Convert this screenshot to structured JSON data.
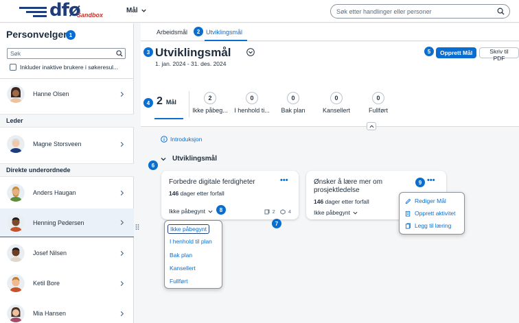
{
  "header": {
    "logo_text": "dfø",
    "logo_tag": "Sandbox",
    "module_label": "Mål",
    "search_placeholder": "Søk etter handlinger eller personer"
  },
  "sidebar": {
    "title": "Personvelger",
    "badge": "1",
    "search_placeholder": "Søk",
    "include_inactive_label": "Inkluder inaktive brukere i søkeresul...",
    "current_user": "Hanne Olsen",
    "leader_group": "Leder",
    "leader": "Magne Storsveen",
    "reports_group": "Direkte underordnede",
    "reports": [
      "Anders Haugan",
      "Henning Pedersen",
      "Josef Nilsen",
      "Ketil Bore",
      "Mia Hansen"
    ]
  },
  "tabs": {
    "items": [
      "Arbeidsmål",
      "Utviklingsmål"
    ],
    "active": "Utviklingsmål",
    "badge": "2"
  },
  "page": {
    "title": "Utviklingsmål",
    "title_badge": "3",
    "date_range": "1. jan. 2024 - 31. des. 2024",
    "create_button": "Opprett Mål",
    "create_badge": "5",
    "pdf_button": "Skriv til PDF"
  },
  "kpis": {
    "badge": "4",
    "main_value": "2",
    "main_label": "Mål",
    "items": [
      {
        "value": "2",
        "label": "Ikke påbeg..."
      },
      {
        "value": "0",
        "label": "I henhold ti..."
      },
      {
        "value": "0",
        "label": "Bak plan"
      },
      {
        "value": "0",
        "label": "Kansellert"
      },
      {
        "value": "0",
        "label": "Fullført"
      }
    ]
  },
  "intro_link": "Introduksjon",
  "section": {
    "title": "Utviklingsmål",
    "badge": "6"
  },
  "cards": [
    {
      "title": "Forbedre digitale ferdigheter",
      "due_number": "146",
      "due_text": " dager etter forfall",
      "status": "Ikke påbegynt",
      "status_badge": "8",
      "count_a": "2",
      "count_b": "4",
      "counts_badge": "7"
    },
    {
      "title_line1": "Ønsker å lære mer om",
      "title_line2": "prosjektledelse",
      "due_number": "146",
      "due_text": " dager etter forfall",
      "status": "Ikke påbegynt",
      "more_badge": "9"
    }
  ],
  "status_dropdown": {
    "options": [
      "Ikke påbegynt",
      "I henhold til plan",
      "Bak plan",
      "Kansellert",
      "Fullført"
    ]
  },
  "context_menu": {
    "items": [
      "Rediger Mål",
      "Opprett aktivitet",
      "Legg til læring"
    ]
  },
  "colors": {
    "accent": "#0a6ed1",
    "brand": "#1f3d7a",
    "sandbox": "#c9302c"
  }
}
